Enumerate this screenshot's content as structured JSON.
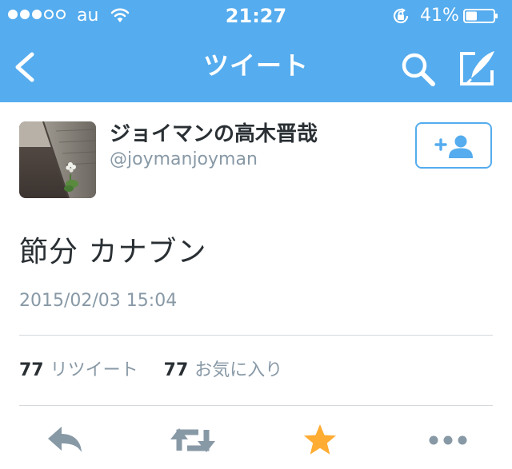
{
  "status_bar": {
    "carrier": "au",
    "time": "21:27",
    "battery_percent": "41%",
    "signal_strength": 3,
    "battery_level": 0.41
  },
  "nav": {
    "title": "ツイート",
    "back_icon": "chevron-left-icon",
    "search_icon": "search-icon",
    "compose_icon": "compose-icon"
  },
  "profile": {
    "display_name": "ジョイマンの高木晋哉",
    "screen_name": "@joymanjoyman",
    "follow_icon": "add-user-icon"
  },
  "tweet": {
    "text": "節分 カナブン",
    "timestamp": "2015/02/03 15:04",
    "retweet_count": "77",
    "retweet_label": "リツイート",
    "favorite_count": "77",
    "favorite_label": "お気に入り"
  },
  "actions": {
    "reply_icon": "reply-icon",
    "retweet_icon": "retweet-icon",
    "favorite_icon": "star-icon",
    "more_icon": "more-icon"
  },
  "colors": {
    "brand": "#55acee",
    "icon_gray": "#8899a6",
    "favorite_active": "#ffac33",
    "text_dark": "#292f33"
  }
}
